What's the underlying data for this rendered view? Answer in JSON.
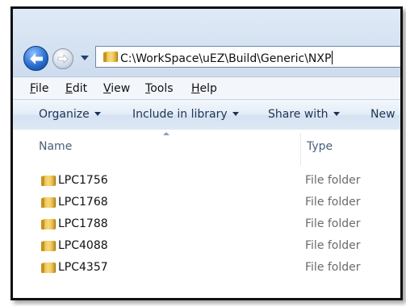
{
  "address": {
    "path": "C:\\WorkSpace\\uEZ\\Build\\Generic\\NXP"
  },
  "menu": [
    {
      "mnemonic": "F",
      "rest": "ile"
    },
    {
      "mnemonic": "E",
      "rest": "dit"
    },
    {
      "mnemonic": "V",
      "rest": "iew"
    },
    {
      "mnemonic": "T",
      "rest": "ools"
    },
    {
      "mnemonic": "H",
      "rest": "elp"
    }
  ],
  "commands": {
    "organize": "Organize",
    "include": "Include in library",
    "share": "Share with",
    "new": "New"
  },
  "columns": {
    "name": "Name",
    "type": "Type"
  },
  "files": [
    {
      "name": "LPC1756",
      "type": "File folder"
    },
    {
      "name": "LPC1768",
      "type": "File folder"
    },
    {
      "name": "LPC1788",
      "type": "File folder"
    },
    {
      "name": "LPC4088",
      "type": "File folder"
    },
    {
      "name": "LPC4357",
      "type": "File folder"
    }
  ]
}
